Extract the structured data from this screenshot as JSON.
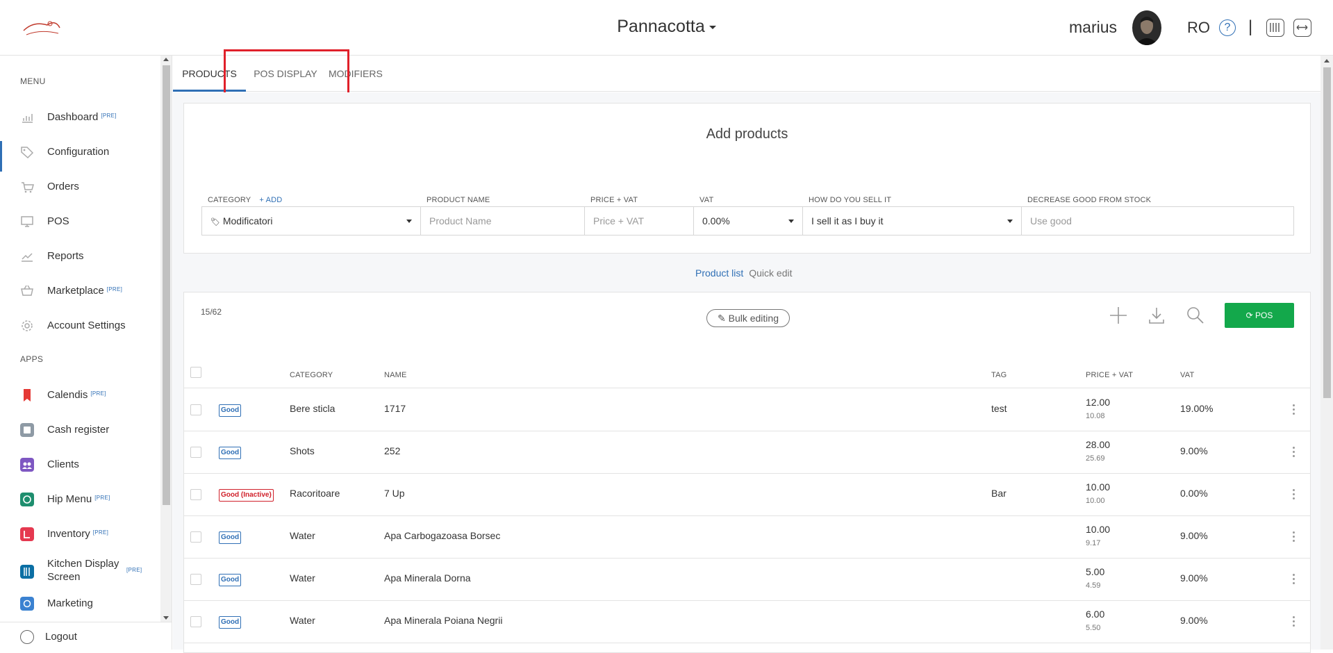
{
  "header": {
    "venue": "Pannacotta",
    "user_name": "marius",
    "language": "RO",
    "help_glyph": "?",
    "separator": "|",
    "logo_icon": "pannacotta-logo"
  },
  "sidebar": {
    "menu_label": "MENU",
    "apps_label": "APPS",
    "menu_items": [
      {
        "label": "Dashboard",
        "badge": "[PRE]",
        "icon": "chart-icon"
      },
      {
        "label": "Configuration",
        "badge": "",
        "icon": "tag-icon"
      },
      {
        "label": "Orders",
        "badge": "",
        "icon": "cart-icon"
      },
      {
        "label": "POS",
        "badge": "",
        "icon": "monitor-icon"
      },
      {
        "label": "Reports",
        "badge": "",
        "icon": "reports-icon"
      },
      {
        "label": "Marketplace",
        "badge": "[PRE]",
        "icon": "basket-icon"
      },
      {
        "label": "Account Settings",
        "badge": "",
        "icon": "gear-icon"
      }
    ],
    "app_items": [
      {
        "label": "Calendis",
        "badge": "[PRE]",
        "icon": "bookmark-icon",
        "color": "#e53935"
      },
      {
        "label": "Cash register",
        "badge": "",
        "icon": "register-icon",
        "color": "#8e9aa5"
      },
      {
        "label": "Clients",
        "badge": "",
        "icon": "clients-icon",
        "color": "#7e57c2"
      },
      {
        "label": "Hip Menu",
        "badge": "[PRE]",
        "icon": "hipmenu-icon",
        "color": "#1e8e6e"
      },
      {
        "label": "Inventory",
        "badge": "[PRE]",
        "icon": "inventory-icon",
        "color": "#e53950"
      },
      {
        "label": "Kitchen Display",
        "label2": "Screen",
        "badge": "[PRE]",
        "icon": "kitchen-icon",
        "color": "#0b6fa4"
      },
      {
        "label": "Marketing",
        "badge": "",
        "icon": "marketing-icon",
        "color": "#3b82d1"
      }
    ],
    "logout": "Logout"
  },
  "tabs": [
    {
      "label": "PRODUCTS"
    },
    {
      "label": "POS DISPLAY"
    },
    {
      "label": "MODIFIERS"
    }
  ],
  "add_products": {
    "title": "Add products",
    "labels": {
      "category": "CATEGORY",
      "category_add": "+ ADD",
      "product_name": "PRODUCT NAME",
      "price_vat": "PRICE + VAT",
      "vat": "VAT",
      "how_sell": "HOW DO YOU SELL IT",
      "decrease": "DECREASE GOOD FROM STOCK"
    },
    "category_value": "Modificatori",
    "product_name_placeholder": "Product Name",
    "price_placeholder": "Price + VAT",
    "vat_value": "0.00%",
    "how_sell_value": "I sell it as I buy it",
    "decrease_placeholder": "Use good"
  },
  "view_toggle": {
    "product_list": "Product list",
    "quick_edit": "Quick edit"
  },
  "product_list": {
    "count": "15/62",
    "bulk_editing": "Bulk editing",
    "pos_button": "POS",
    "columns": {
      "category": "CATEGORY",
      "name": "NAME",
      "tag": "TAG",
      "price": "PRICE + VAT",
      "vat": "VAT"
    },
    "rows": [
      {
        "badge": "Good",
        "inactive": false,
        "category": "Bere sticla",
        "name": "1717",
        "tag": "test",
        "price": "12.00",
        "price_sub": "10.08",
        "vat": "19.00%"
      },
      {
        "badge": "Good",
        "inactive": false,
        "category": "Shots",
        "name": "252",
        "tag": "",
        "price": "28.00",
        "price_sub": "25.69",
        "vat": "9.00%"
      },
      {
        "badge": "Good (Inactive)",
        "inactive": true,
        "category": "Racoritoare",
        "name": "7 Up",
        "tag": "Bar",
        "price": "10.00",
        "price_sub": "10.00",
        "vat": "0.00%"
      },
      {
        "badge": "Good",
        "inactive": false,
        "category": "Water",
        "name": "Apa Carbogazoasa Borsec",
        "tag": "",
        "price": "10.00",
        "price_sub": "9.17",
        "vat": "9.00%"
      },
      {
        "badge": "Good",
        "inactive": false,
        "category": "Water",
        "name": "Apa Minerala Dorna",
        "tag": "",
        "price": "5.00",
        "price_sub": "4.59",
        "vat": "9.00%"
      },
      {
        "badge": "Good",
        "inactive": false,
        "category": "Water",
        "name": "Apa Minerala Poiana Negrii",
        "tag": "",
        "price": "6.00",
        "price_sub": "5.50",
        "vat": "9.00%"
      }
    ]
  },
  "colors": {
    "accent": "#2f6fb5",
    "pos_green": "#13a84b",
    "inactive_red": "#d0202a",
    "highlight_red": "#e0202a"
  }
}
